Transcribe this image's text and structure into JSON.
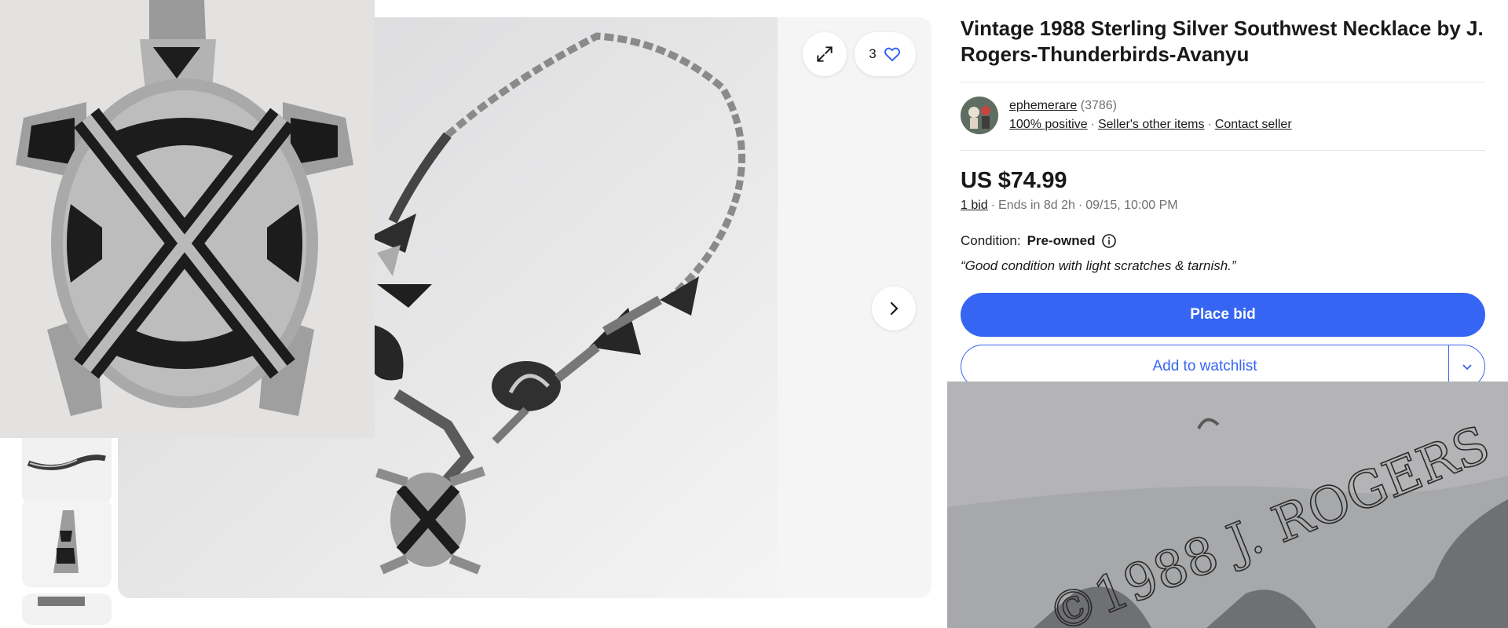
{
  "listing": {
    "title": "Vintage 1988 Sterling Silver Southwest Necklace by J. Rogers-Thunderbirds-Avanyu"
  },
  "gallery": {
    "watch_count": "3",
    "icons": {
      "expand": "expand-icon",
      "heart": "heart-icon",
      "next": "chevron-right-icon"
    }
  },
  "seller": {
    "name": "ephemerare",
    "feedback_count": "(3786)",
    "positive": "100% positive",
    "other_items": "Seller's other items",
    "contact": "Contact seller"
  },
  "pricing": {
    "price": "US $74.99",
    "bids": "1 bid",
    "ends": "Ends in 8d 2h",
    "end_time": "09/15, 10:00 PM"
  },
  "condition": {
    "label": "Condition:",
    "value": "Pre-owned",
    "note": "Good condition with light scratches & tarnish.",
    "open_quote": "“",
    "close_quote": "”"
  },
  "actions": {
    "place_bid": "Place bid",
    "add_watchlist": "Add to watchlist"
  },
  "overlays": {
    "engraving": "©1988 J. ROGERS"
  },
  "colors": {
    "accent": "#3665f3",
    "text": "#191919",
    "muted": "#707070"
  }
}
